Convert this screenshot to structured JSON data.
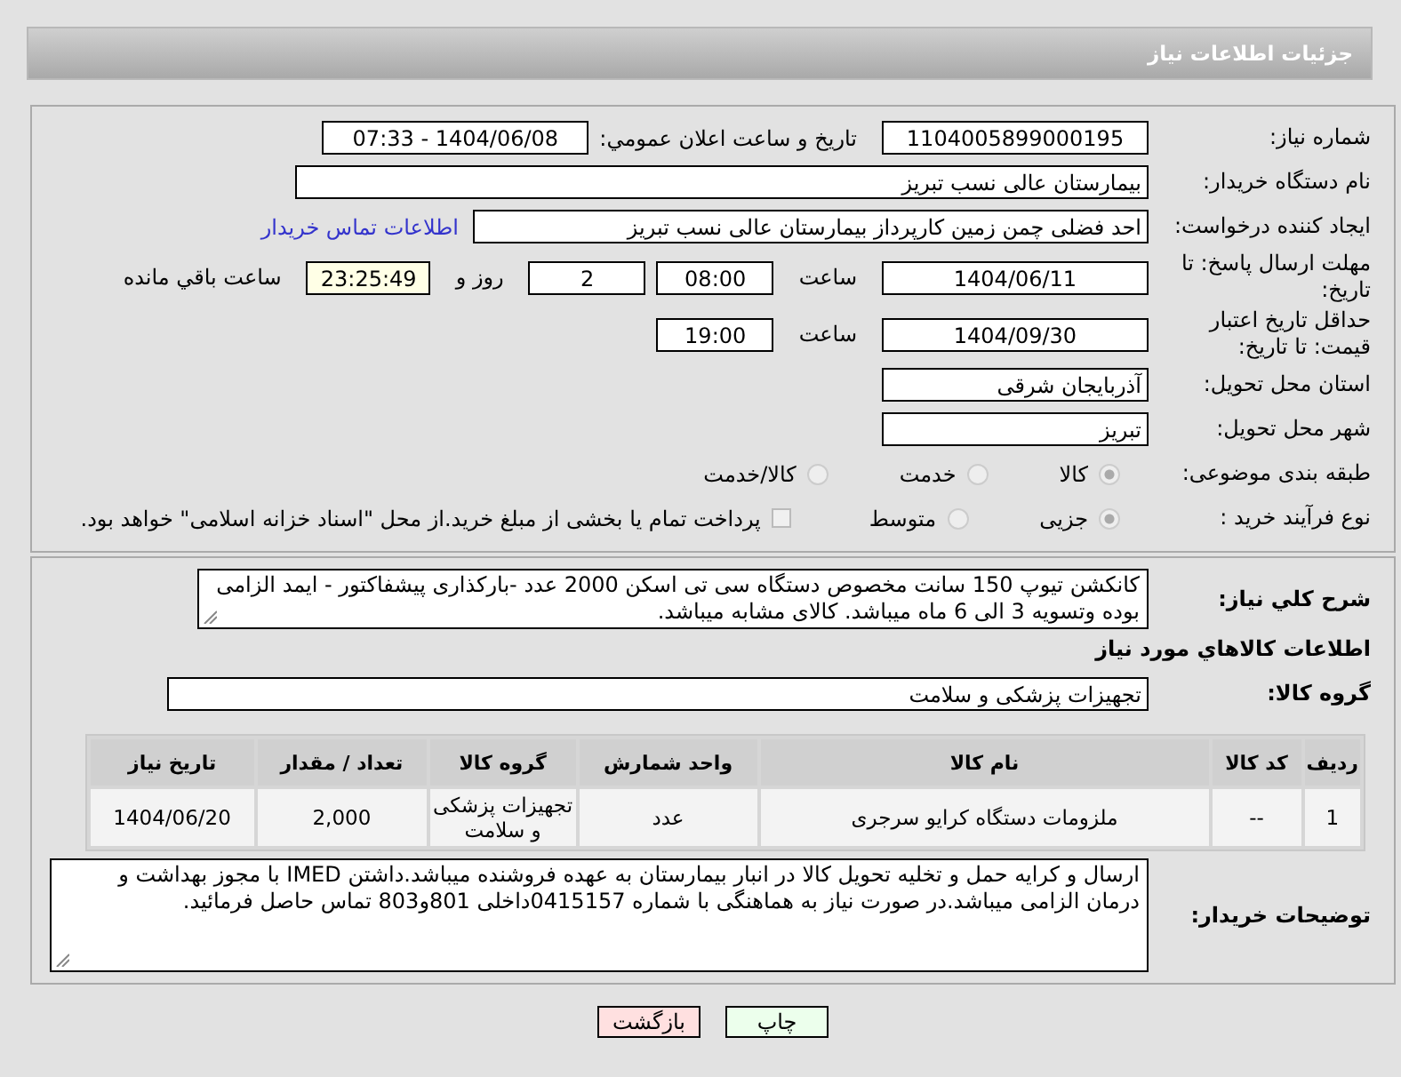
{
  "header": {
    "title": "جزئیات اطلاعات نیاز"
  },
  "need_number": {
    "label": "شماره نیاز:",
    "value": "1104005899000195"
  },
  "announce": {
    "label": "تاریخ و ساعت اعلان عمومي:",
    "value": "1404/06/08 - 07:33"
  },
  "buyer_org": {
    "label": "نام دستگاه خریدار:",
    "value": "بیمارستان عالی نسب تبریز"
  },
  "creator": {
    "label": "ایجاد کننده درخواست:",
    "value": "احد فضلی چمن زمین کارپرداز  بیمارستان عالی نسب تبریز",
    "link": "اطلاعات تماس خریدار"
  },
  "reply_deadline": {
    "label": "مهلت ارسال پاسخ: تا تاریخ:",
    "date": "1404/06/11",
    "time_label": "ساعت",
    "time": "08:00",
    "days": "2",
    "days_label": "روز و",
    "remaining": "23:25:49",
    "remaining_label": "ساعت باقي مانده"
  },
  "price_validity": {
    "label": "حداقل تاریخ اعتبار قیمت: تا تاریخ:",
    "date": "1404/09/30",
    "time_label": "ساعت",
    "time": "19:00"
  },
  "province": {
    "label": "استان محل تحویل:",
    "value": "آذربایجان شرقی"
  },
  "city": {
    "label": "شهر محل تحویل:",
    "value": "تبریز"
  },
  "category": {
    "label": "طبقه بندی موضوعی:",
    "options": [
      {
        "label": "کالا",
        "selected": true
      },
      {
        "label": "خدمت",
        "selected": false
      },
      {
        "label": "کالا/خدمت",
        "selected": false
      }
    ]
  },
  "process": {
    "label": "نوع فرآیند خرید :",
    "options": [
      {
        "label": "جزیی",
        "selected": true
      },
      {
        "label": "متوسط",
        "selected": false
      }
    ],
    "payment": {
      "checked": false,
      "text": "پرداخت تمام یا بخشی از مبلغ خرید.از محل \"اسناد خزانه اسلامی\" خواهد بود."
    }
  },
  "description": {
    "label": "شرح کلي نياز:",
    "value": "کانکشن تیوپ 150 سانت مخصوص دستگاه سی تی اسکن 2000 عدد -بارکذاری پیشفاکتور - ایمد الزامی بوده وتسویه 3 الی 6 ماه میباشد. کالای مشابه میباشد."
  },
  "items_title": "اطلاعات کالاهاي مورد نياز",
  "goods_group": {
    "label": "گروه کالا:",
    "value": "تجهیزات پزشکی و سلامت"
  },
  "table": {
    "columns": [
      "ردیف",
      "کد کالا",
      "نام کالا",
      "واحد شمارش",
      "گروه کالا",
      "تعداد / مقدار",
      "تاریخ نیاز"
    ],
    "rows": [
      [
        "1",
        "--",
        "ملزومات دستگاه کرایو سرجری",
        "عدد",
        "تجهیزات پزشکی و سلامت",
        "2,000",
        "1404/06/20"
      ]
    ]
  },
  "buyer_notes": {
    "label": "توضیحات خریدار:",
    "value": "ارسال و کرایه حمل و تخلیه  تحویل کالا در انبار بیمارستان به عهده فروشنده میباشد.داشتن IMED با مجوز بهداشت و درمان الزامی میباشد.در صورت نیاز به هماهنگی با شماره 0415157داخلی 801و803 تماس حاصل فرمائید."
  },
  "buttons": [
    {
      "label": "چاپ",
      "kind": "print"
    },
    {
      "label": "بازگشت",
      "kind": "back"
    }
  ]
}
